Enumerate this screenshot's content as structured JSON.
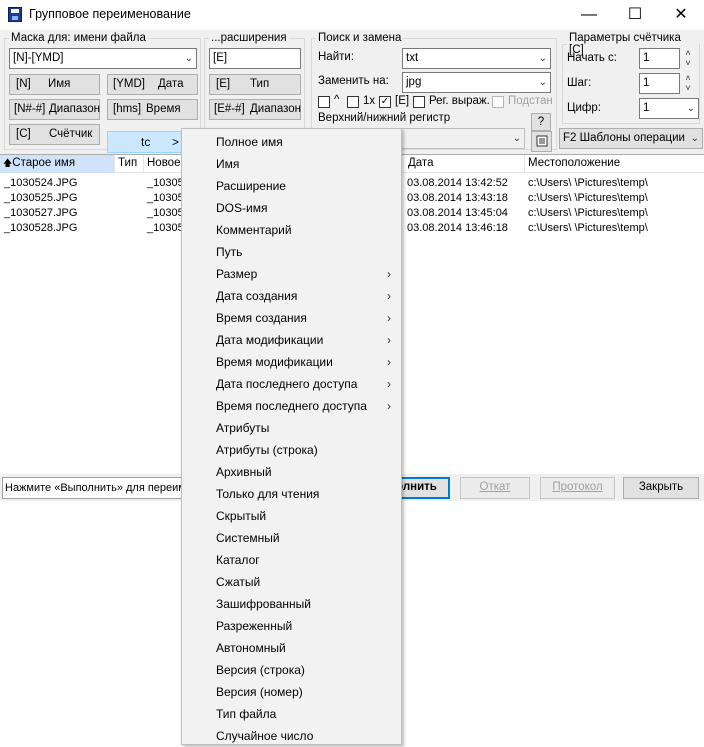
{
  "window": {
    "title": "Групповое переименование",
    "minimize": "—",
    "maximize": "☐",
    "close": "✕"
  },
  "mask_file": {
    "legend": "Маска для: имени файла",
    "value": "[N]-[YMD]",
    "buttons": [
      {
        "code": "[N]",
        "label": "Имя"
      },
      {
        "code": "[YMD]",
        "label": "Дата"
      },
      {
        "code": "[N#-#]",
        "label": "Диапазон"
      },
      {
        "code": "[hms]",
        "label": "Время"
      },
      {
        "code": "[C]",
        "label": "Счётчик"
      }
    ],
    "plugin_button": {
      "label": "tc",
      "arrow": ">"
    }
  },
  "mask_ext": {
    "legend": "...расширения",
    "value": "[E]",
    "buttons": [
      {
        "code": "[E]",
        "label": "Тип"
      },
      {
        "code": "[E#-#]",
        "label": "Диапазон"
      }
    ]
  },
  "search": {
    "legend": "Поиск и замена",
    "find_label": "Найти:",
    "find_value": "txt",
    "replace_label": "Заменить на:",
    "replace_value": "jpg",
    "options": [
      {
        "label": "^",
        "checked": false
      },
      {
        "label": "1x",
        "checked": false
      },
      {
        "label": "[E]",
        "checked": true
      },
      {
        "label": "Рег. выраж.",
        "checked": false
      },
      {
        "label": "Подстан",
        "checked": false,
        "disabled": true
      }
    ],
    "case_label": "Верхний/нижний регистр",
    "help_label": "?",
    "case_value": ""
  },
  "counter": {
    "legend": "Параметры счётчика [C]",
    "start_label": "Начать с:",
    "start_value": "1",
    "step_label": "Шаг:",
    "step_value": "1",
    "digits_label": "Цифр:",
    "digits_value": "1",
    "templates_button": "F2 Шаблоны операции"
  },
  "file_list": {
    "columns": [
      "Старое имя",
      "Тип",
      "Новое",
      "Дата",
      "Местоположение"
    ],
    "sort_arrow": "🡅",
    "rows": [
      {
        "old": "_1030524.JPG",
        "new": "_10305",
        "date": "03.08.2014 13:42:52",
        "path": "c:\\Users\\ \\Pictures\\temp\\"
      },
      {
        "old": "_1030525.JPG",
        "new": "_10305",
        "date": "03.08.2014 13:43:18",
        "path": "c:\\Users\\ \\Pictures\\temp\\"
      },
      {
        "old": "_1030527.JPG",
        "new": "_10305",
        "date": "03.08.2014 13:45:04",
        "path": "c:\\Users\\ \\Pictures\\temp\\"
      },
      {
        "old": "_1030528.JPG",
        "new": "_10305",
        "date": "03.08.2014 13:46:18",
        "path": "c:\\Users\\ \\Pictures\\temp\\"
      }
    ]
  },
  "bottom": {
    "status": "Нажмите «Выполнить» для переим",
    "execute": "олнить",
    "undo": "Откат",
    "log": "Протокол",
    "close": "Закрыть"
  },
  "menu": {
    "items": [
      {
        "label": "Полное имя",
        "sub": false
      },
      {
        "label": "Имя",
        "sub": false
      },
      {
        "label": "Расширение",
        "sub": false
      },
      {
        "label": "DOS-имя",
        "sub": false
      },
      {
        "label": "Комментарий",
        "sub": false
      },
      {
        "label": "Путь",
        "sub": false
      },
      {
        "label": "Размер",
        "sub": true
      },
      {
        "label": "Дата создания",
        "sub": true
      },
      {
        "label": "Время создания",
        "sub": true
      },
      {
        "label": "Дата модификации",
        "sub": true
      },
      {
        "label": "Время модификации",
        "sub": true
      },
      {
        "label": "Дата последнего доступа",
        "sub": true
      },
      {
        "label": "Время последнего доступа",
        "sub": true
      },
      {
        "label": "Атрибуты",
        "sub": false
      },
      {
        "label": "Атрибуты (строка)",
        "sub": false
      },
      {
        "label": "Архивный",
        "sub": false
      },
      {
        "label": "Только для чтения",
        "sub": false
      },
      {
        "label": "Скрытый",
        "sub": false
      },
      {
        "label": "Системный",
        "sub": false
      },
      {
        "label": "Каталог",
        "sub": false
      },
      {
        "label": "Сжатый",
        "sub": false
      },
      {
        "label": "Зашифрованный",
        "sub": false
      },
      {
        "label": "Разреженный",
        "sub": false
      },
      {
        "label": "Автономный",
        "sub": false
      },
      {
        "label": "Версия (строка)",
        "sub": false
      },
      {
        "label": "Версия (номер)",
        "sub": false
      },
      {
        "label": "Тип файла",
        "sub": false
      },
      {
        "label": "Случайное число",
        "sub": false
      }
    ],
    "submenu_arrow": "›"
  },
  "colors": {
    "accent": "#0078d7",
    "menu_bg": "#f2f2f2",
    "highlight": "#cce8ff",
    "sorted_col": "#cfe4fb"
  },
  "icons": [
    "app-icon",
    "chevron-down-icon",
    "sort-up-icon",
    "spin-icon",
    "templates-icon",
    "help-icon",
    "submenu-arrow-icon"
  ]
}
